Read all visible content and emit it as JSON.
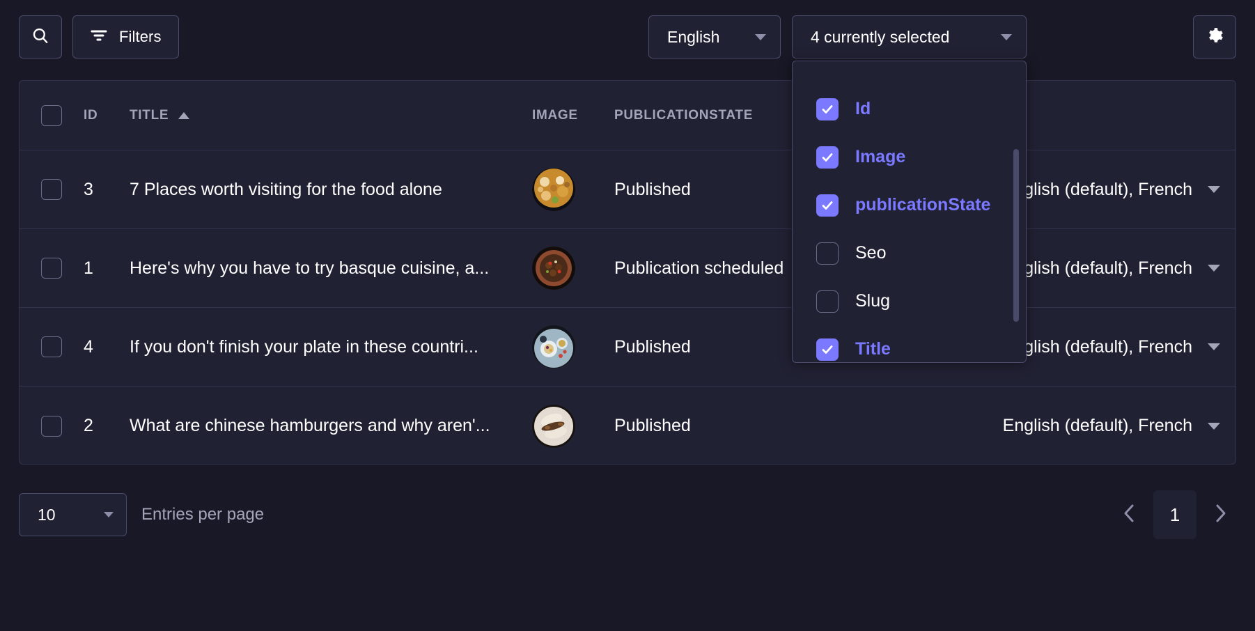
{
  "toolbar": {
    "search_icon": "search-icon",
    "filters_label": "Filters",
    "filters_icon": "filter-icon",
    "language_select": {
      "value": "English",
      "caret_icon": "chevron-down-icon"
    },
    "fields_select": {
      "value": "4 currently selected",
      "caret_icon": "chevron-down-icon"
    },
    "settings_icon": "gear-icon"
  },
  "fields_dropdown": {
    "options": [
      {
        "label": "Id",
        "checked": true
      },
      {
        "label": "Image",
        "checked": true
      },
      {
        "label": "publicationState",
        "checked": true
      },
      {
        "label": "Seo",
        "checked": false
      },
      {
        "label": "Slug",
        "checked": false
      },
      {
        "label": "Title",
        "checked": true
      }
    ]
  },
  "table": {
    "columns": [
      "ID",
      "TITLE",
      "IMAGE",
      "PUBLICATIONSTATE",
      ""
    ],
    "sorted_column": "TITLE",
    "sort_direction": "asc",
    "rows": [
      {
        "id": "3",
        "title": "7 Places worth visiting for the food alone",
        "image": "seafood-paella-thumbnail",
        "publicationState": "Published",
        "locales": "English (default), French"
      },
      {
        "id": "1",
        "title": "Here's why you have to try basque cuisine, a...",
        "image": "chili-bowl-thumbnail",
        "publicationState": "Publication scheduled",
        "locales": "English (default), French"
      },
      {
        "id": "4",
        "title": "If you don't finish your plate in these countri...",
        "image": "breakfast-plate-thumbnail",
        "publicationState": "Published",
        "locales": "English (default), French"
      },
      {
        "id": "2",
        "title": "What are chinese hamburgers and why aren'...",
        "image": "sandwich-thumbnail",
        "publicationState": "Published",
        "locales": "English (default), French"
      }
    ]
  },
  "footer": {
    "page_size": "10",
    "entries_label": "Entries per page",
    "prev_icon": "chevron-left-icon",
    "next_icon": "chevron-right-icon",
    "current_page": "1"
  },
  "colors": {
    "accent": "#7b79ff",
    "surface": "#212134",
    "background": "#181826",
    "border": "#32324d",
    "muted_text": "#a5a5ba"
  }
}
